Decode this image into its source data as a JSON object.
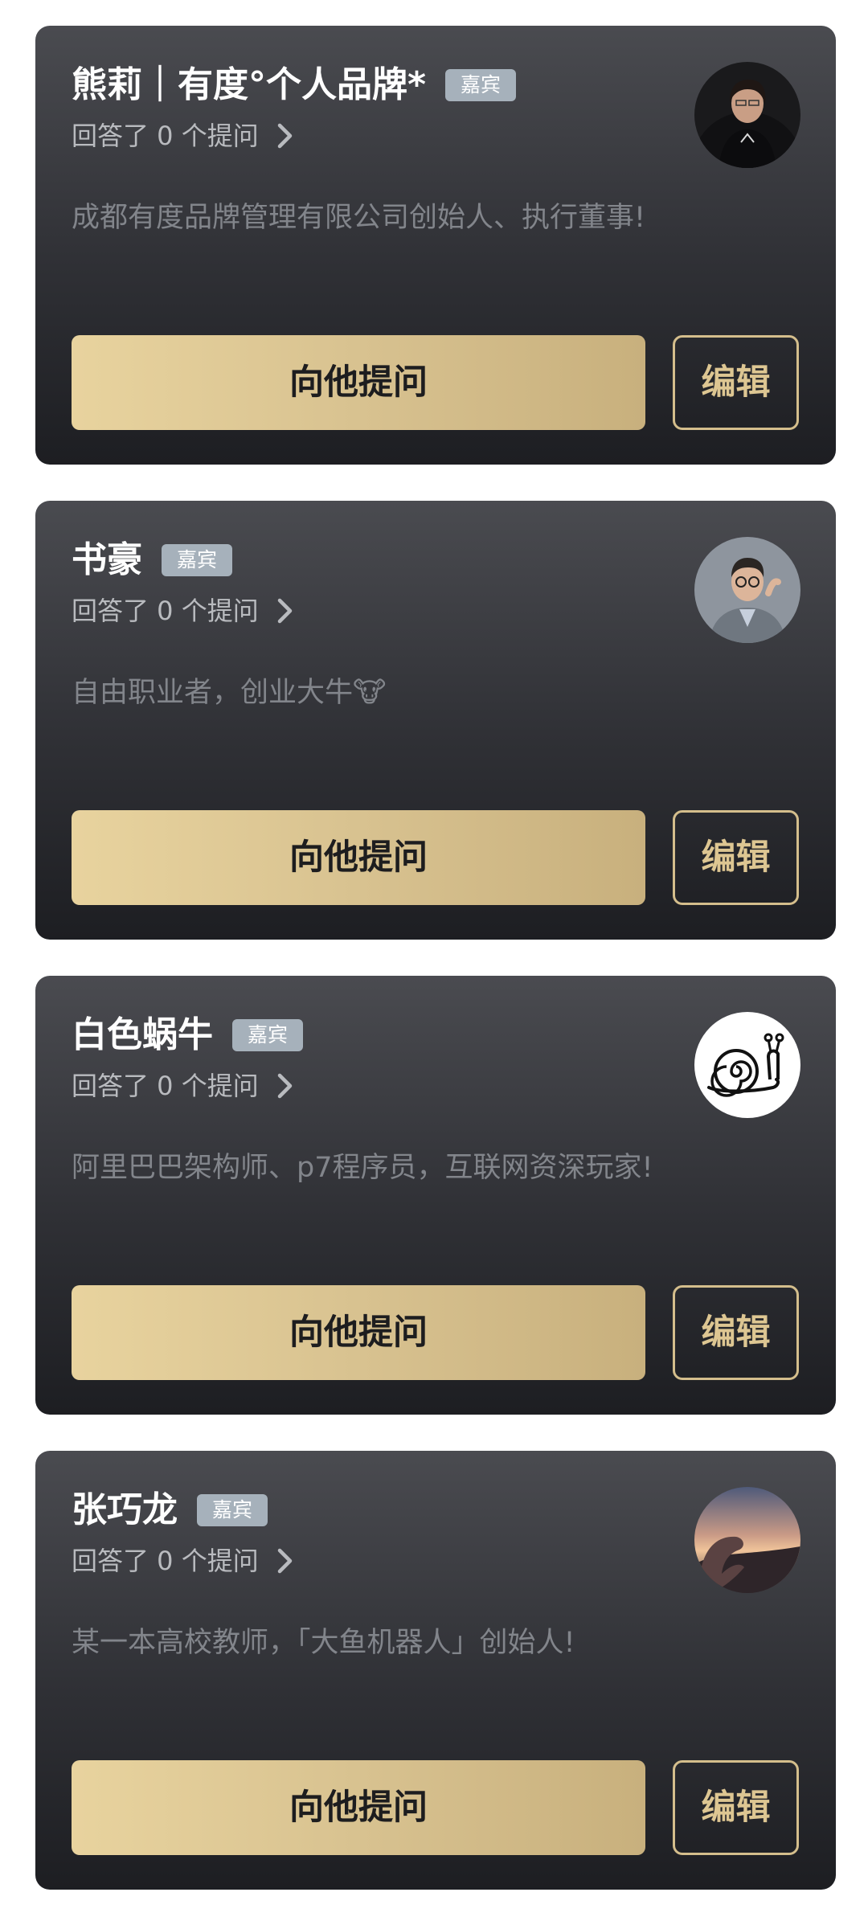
{
  "guest_badge": "嘉宾",
  "ask_label": "向他提问",
  "edit_label": "编辑",
  "cards": [
    {
      "name": "熊莉｜有度°个人品牌*",
      "stats": "回答了 0 个提问",
      "description": "成都有度品牌管理有限公司创始人、执行董事!",
      "avatar": "portrait-woman-dark-suit"
    },
    {
      "name": "书豪",
      "stats": "回答了 0 个提问",
      "description": "自由职业者，创业大牛🐮",
      "avatar": "portrait-man-glasses"
    },
    {
      "name": "白色蜗牛",
      "stats": "回答了 0 个提问",
      "description": "阿里巴巴架构师、p7程序员，互联网资深玩家!",
      "avatar": "snail-icon"
    },
    {
      "name": "张巧龙",
      "stats": "回答了 0 个提问",
      "description": "某一本高校教师，「大鱼机器人」创始人!",
      "avatar": "sunset-hand-photo"
    }
  ]
}
